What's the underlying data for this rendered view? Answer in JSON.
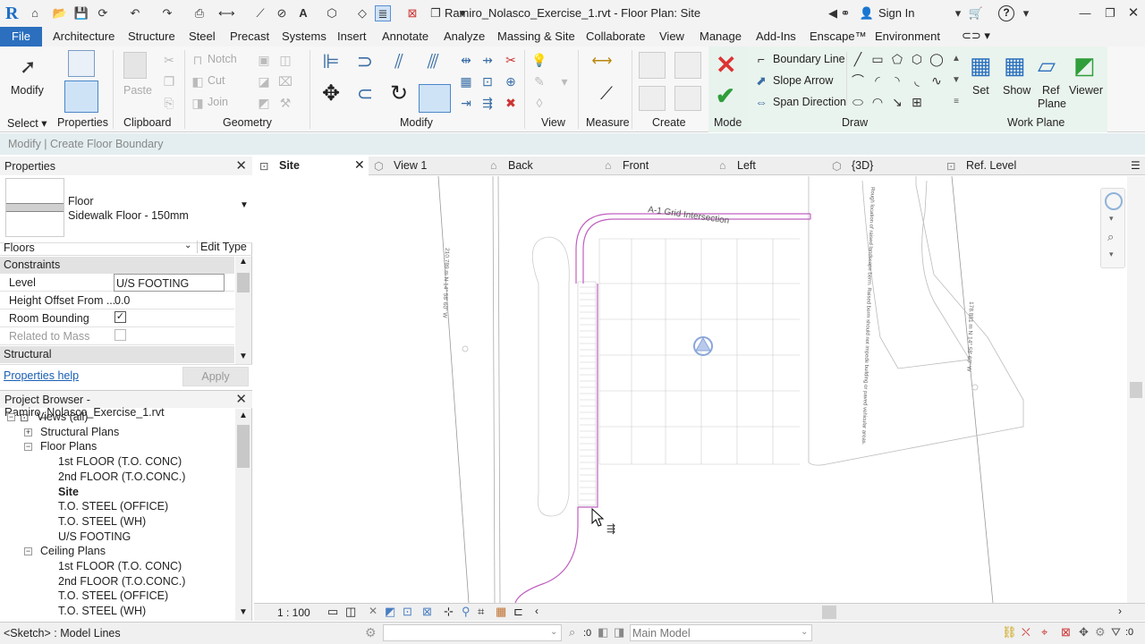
{
  "titlebar": {
    "app_logo": "R",
    "doc_title": "Ramiro_Nolasco_Exercise_1.rvt - Floor Plan: Site",
    "sign_in": "Sign In",
    "help": "?"
  },
  "menu": {
    "file": "File",
    "tabs": [
      "Architecture",
      "Structure",
      "Steel",
      "Precast",
      "Systems",
      "Insert",
      "Annotate",
      "Analyze",
      "Massing & Site",
      "Collaborate",
      "View",
      "Manage",
      "Add-Ins",
      "Enscape™",
      "Environment"
    ]
  },
  "ribbon": {
    "modify_label": "Modify",
    "select_label": "Select ▾",
    "properties_label": "Properties",
    "clipboard": {
      "paste": "Paste",
      "label": "Clipboard"
    },
    "geometry": {
      "notch": "Notch",
      "cut": "Cut",
      "join": "Join",
      "label": "Geometry"
    },
    "modify_panel_label": "Modify",
    "view_panel_label": "View",
    "measure_panel_label": "Measure",
    "create_panel_label": "Create",
    "mode_panel_label": "Mode",
    "draw": {
      "boundary_line": "Boundary Line",
      "slope_arrow": "Slope Arrow",
      "span_direction": "Span Direction",
      "label": "Draw"
    },
    "work_plane": {
      "set": "Set",
      "show": "Show",
      "ref": "Ref",
      "plane": "Plane",
      "viewer": "Viewer",
      "label": "Work Plane"
    }
  },
  "options_bar": {
    "text": "Modify | Create Floor Boundary"
  },
  "properties": {
    "title": "Properties",
    "type_family": "Floor",
    "type_name": "Sidewalk Floor - 150mm",
    "filter": "Floors",
    "edit_type": "Edit Type",
    "sections": [
      "Constraints",
      "Structural"
    ],
    "rows": [
      {
        "label": "Level",
        "value": "U/S FOOTING"
      },
      {
        "label": "Height Offset From ...",
        "value": "0.0"
      },
      {
        "label": "Room Bounding",
        "value": "✓"
      },
      {
        "label": "Related to Mass",
        "value": ""
      }
    ],
    "help_link": "Properties help",
    "apply": "Apply"
  },
  "browser": {
    "title": "Project Browser - Ramiro_Nolasco_Exercise_1.rvt",
    "root": "Views (all)",
    "groups": [
      {
        "label": "Structural Plans",
        "expanded": false,
        "items": []
      },
      {
        "label": "Floor Plans",
        "expanded": true,
        "items": [
          "1st FLOOR (T.O. CONC)",
          "2nd FLOOR (T.O.CONC.)",
          "Site",
          "T.O. STEEL (OFFICE)",
          "T.O. STEEL (WH)",
          "U/S FOOTING"
        ]
      },
      {
        "label": "Ceiling Plans",
        "expanded": true,
        "items": [
          "1st FLOOR (T.O. CONC)",
          "2nd FLOOR (T.O.CONC.)",
          "T.O. STEEL (OFFICE)",
          "T.O. STEEL (WH)"
        ]
      }
    ]
  },
  "view_tabs": [
    "Site",
    "View 1",
    "Back",
    "Front",
    "Left",
    "{3D}",
    "Ref. Level"
  ],
  "canvas": {
    "grid_text": "A-1 Grid Intersection",
    "bearing_left": "210.789 m   N 14° 58' 60\" W",
    "bearing_right": "178.881 m   N 14° 58' 60\" W",
    "note_text": "Rough location of raised landscape berm. Raised berm should not impede building or paved vehicular areas."
  },
  "view_bar": {
    "scale": "1 : 100"
  },
  "status": {
    "left": "<Sketch> : Model Lines",
    "count": ":0",
    "model": "Main Model"
  },
  "colors": {
    "accent": "#2b6fbe",
    "sketch": "#c060c0"
  }
}
